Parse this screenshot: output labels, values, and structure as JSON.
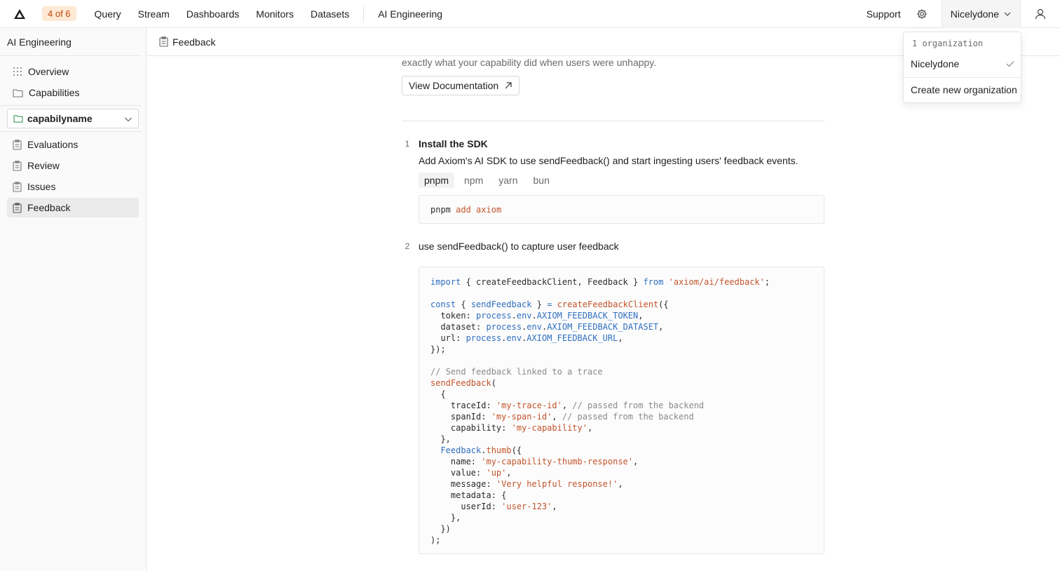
{
  "topbar": {
    "badge": "4 of 6",
    "nav": [
      "Query",
      "Stream",
      "Dashboards",
      "Monitors",
      "Datasets"
    ],
    "section": "AI Engineering",
    "support": "Support",
    "org": "Nicelydone"
  },
  "sidebar": {
    "title": "AI Engineering",
    "items_top": [
      {
        "label": "Overview",
        "icon": "grid-icon"
      },
      {
        "label": "Capabilities",
        "icon": "folder-icon"
      }
    ],
    "capability": "capabilyname",
    "items_bottom": [
      {
        "label": "Evaluations",
        "icon": "clipboard-icon"
      },
      {
        "label": "Review",
        "icon": "clipboard-icon"
      },
      {
        "label": "Issues",
        "icon": "clipboard-icon"
      },
      {
        "label": "Feedback",
        "icon": "clipboard-icon",
        "active": true
      }
    ]
  },
  "subheader": {
    "title": "Feedback"
  },
  "main": {
    "intro": "exactly what your capability did when users were unhappy.",
    "doc_button": "View Documentation",
    "step1": {
      "num": "1",
      "title": "Install the SDK",
      "desc": "Add Axiom's AI SDK to use sendFeedback() and start ingesting users' feedback events.",
      "tabs": [
        "pnpm",
        "npm",
        "yarn",
        "bun"
      ],
      "active_tab": "pnpm",
      "cmd": "pnpm",
      "cmd_args": "add axiom"
    },
    "step2": {
      "num": "2",
      "title": "use sendFeedback() to capture user feedback"
    }
  },
  "dropdown": {
    "header": "1 organization",
    "org": "Nicelydone",
    "create": "Create new organization"
  },
  "colors": {
    "accent_badge_bg": "#fde9d4",
    "accent_badge_text": "#c2410c",
    "keyword": "#2f6fc0",
    "string": "#c2542b",
    "comment": "#8a8a8a"
  }
}
